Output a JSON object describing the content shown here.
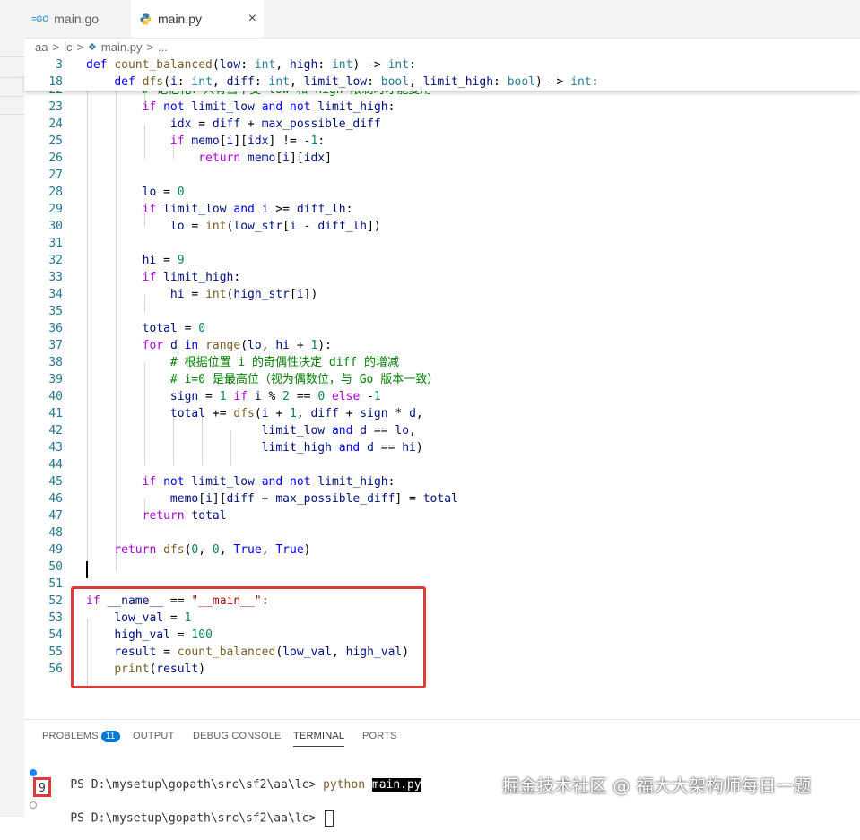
{
  "tabs": [
    {
      "icon": "go-file-icon",
      "label": "main.go"
    },
    {
      "icon": "python-file-icon",
      "label": "main.py"
    }
  ],
  "breadcrumb": [
    "aa",
    "lc",
    "main.py",
    "..."
  ],
  "sticky": [
    {
      "num": "3",
      "code": "def count_balanced(low: int, high: int) -> int:"
    },
    {
      "num": "18",
      "code": "    def dfs(i: int, diff: int, limit_low: bool, limit_high: bool) -> int:"
    }
  ],
  "lines": [
    {
      "num": "22",
      "code": "        # 记忆化：只有当不受 low 和 high 限制时才能复用"
    },
    {
      "num": "23",
      "code": "        if not limit_low and not limit_high:"
    },
    {
      "num": "24",
      "code": "            idx = diff + max_possible_diff"
    },
    {
      "num": "25",
      "code": "            if memo[i][idx] != -1:"
    },
    {
      "num": "26",
      "code": "                return memo[i][idx]"
    },
    {
      "num": "27",
      "code": ""
    },
    {
      "num": "28",
      "code": "        lo = 0"
    },
    {
      "num": "29",
      "code": "        if limit_low and i >= diff_lh:"
    },
    {
      "num": "30",
      "code": "            lo = int(low_str[i - diff_lh])"
    },
    {
      "num": "31",
      "code": ""
    },
    {
      "num": "32",
      "code": "        hi = 9"
    },
    {
      "num": "33",
      "code": "        if limit_high:"
    },
    {
      "num": "34",
      "code": "            hi = int(high_str[i])"
    },
    {
      "num": "35",
      "code": ""
    },
    {
      "num": "36",
      "code": "        total = 0"
    },
    {
      "num": "37",
      "code": "        for d in range(lo, hi + 1):"
    },
    {
      "num": "38",
      "code": "            # 根据位置 i 的奇偶性决定 diff 的增减"
    },
    {
      "num": "39",
      "code": "            # i=0 是最高位（视为偶数位，与 Go 版本一致）"
    },
    {
      "num": "40",
      "code": "            sign = 1 if i % 2 == 0 else -1"
    },
    {
      "num": "41",
      "code": "            total += dfs(i + 1, diff + sign * d,"
    },
    {
      "num": "42",
      "code": "                         limit_low and d == lo,"
    },
    {
      "num": "43",
      "code": "                         limit_high and d == hi)"
    },
    {
      "num": "44",
      "code": ""
    },
    {
      "num": "45",
      "code": "        if not limit_low and not limit_high:"
    },
    {
      "num": "46",
      "code": "            memo[i][diff + max_possible_diff] = total"
    },
    {
      "num": "47",
      "code": "        return total"
    },
    {
      "num": "48",
      "code": ""
    },
    {
      "num": "49",
      "code": "    return dfs(0, 0, True, True)"
    },
    {
      "num": "50",
      "code": ""
    },
    {
      "num": "51",
      "code": ""
    },
    {
      "num": "52",
      "code": "if __name__ == \"__main__\":"
    },
    {
      "num": "53",
      "code": "    low_val = 1"
    },
    {
      "num": "54",
      "code": "    high_val = 100"
    },
    {
      "num": "55",
      "code": "    result = count_balanced(low_val, high_val)"
    },
    {
      "num": "56",
      "code": "    print(result)"
    }
  ],
  "panel": {
    "tabs": [
      "PROBLEMS",
      "OUTPUT",
      "DEBUG CONSOLE",
      "TERMINAL",
      "PORTS"
    ],
    "problems_count": "11",
    "active_tab": "TERMINAL"
  },
  "terminal": {
    "prompt1": "PS D:\\mysetup\\gopath\\src\\sf2\\aa\\lc> ",
    "cmd": "python",
    "arg": "main.py",
    "output": "9",
    "prompt2": "PS D:\\mysetup\\gopath\\src\\sf2\\aa\\lc> "
  },
  "watermark": "掘金技术社区 @ 福大大架构师每日一题"
}
